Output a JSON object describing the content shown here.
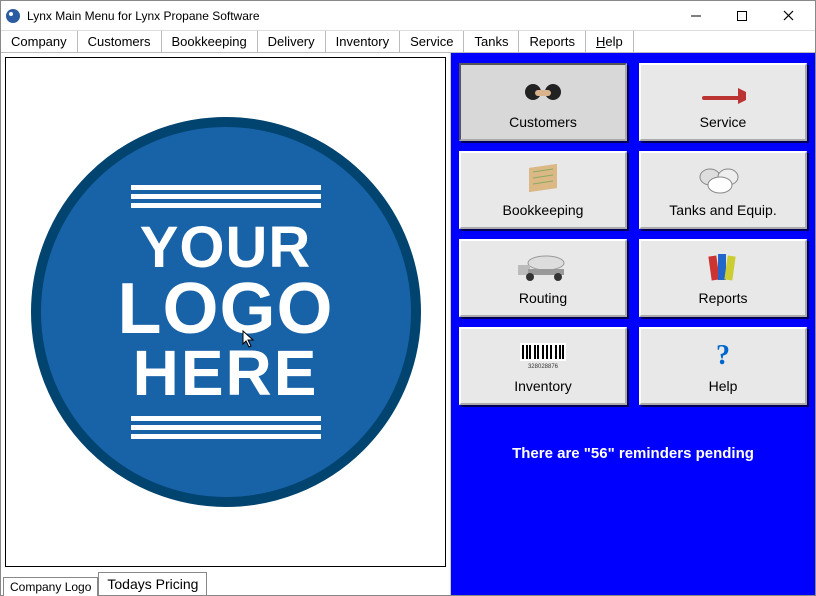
{
  "window": {
    "title": "Lynx Main Menu for Lynx Propane Software"
  },
  "menubar": {
    "items": [
      "Company",
      "Customers",
      "Bookkeeping",
      "Delivery",
      "Inventory",
      "Service",
      "Tanks",
      "Reports",
      "Help"
    ]
  },
  "logo": {
    "line1": "YOUR",
    "line2": "LOGO",
    "line3": "HERE"
  },
  "tabs": {
    "active": "Company Logo",
    "inactive": "Todays Pricing"
  },
  "buttons": {
    "customers": "Customers",
    "service": "Service",
    "bookkeeping": "Bookkeeping",
    "tanks": "Tanks and Equip.",
    "routing": "Routing",
    "reports": "Reports",
    "inventory": "Inventory",
    "help": "Help"
  },
  "reminder": {
    "text": "There are \"56\" reminders pending",
    "count": 56
  }
}
